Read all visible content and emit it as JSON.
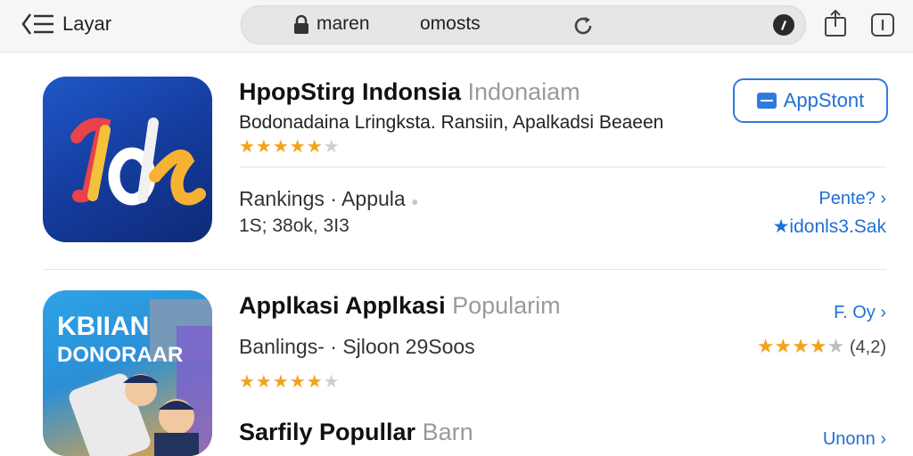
{
  "toolbar": {
    "back_label": "Layar",
    "address_host": "maren",
    "address_path": "omosts"
  },
  "colors": {
    "accent": "#1f6fd6",
    "star": "#f2a31b"
  },
  "apps": [
    {
      "icon_text": "Idk",
      "title": "HpopStirg Indonsia",
      "title_grey": "Indonaiam",
      "subtitle": "Bodonadaina Lringksta. Ransiin, Apalkadsi Beaeen",
      "rating_stars": 4,
      "action_label": "AppStont",
      "meta_label": "Rankings · Appula",
      "meta_value": "1S; 38ok, 3I3",
      "link_top": "Pente? ›",
      "link_bottom": "★idonls3.Sak"
    },
    {
      "icon_text": "KBIIAN DONORAAR",
      "title": "Applkasi Applkasi",
      "title_grey": "Popularim",
      "meta_label": "Banlings- · Sjloon 29Soos",
      "rating_stars": 4.5,
      "link_top": "F. Oy ›",
      "right_rating_text": "(4,2)"
    },
    {
      "title": "Sarfily Popullar",
      "title_grey": "Barn",
      "link_top": "Unonn ›"
    }
  ]
}
